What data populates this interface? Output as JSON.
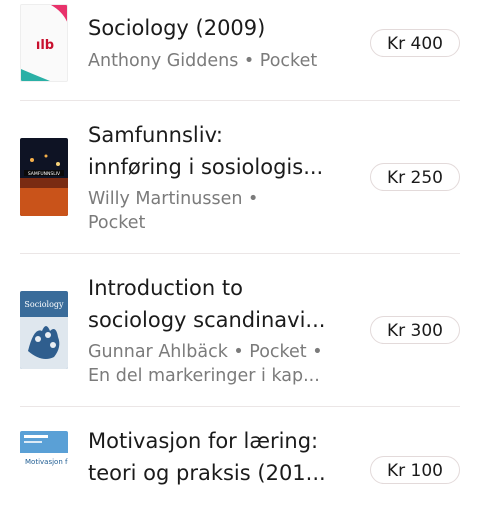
{
  "items": [
    {
      "title_lines": [
        "Sociology (2009)"
      ],
      "subtitle_lines": [
        "Anthony Giddens • Pocket"
      ],
      "price": "Kr 400",
      "cover": {
        "kind": "placeholder",
        "text": "ılb",
        "accent_colors": [
          "#e8326b",
          "#2ab0a6"
        ]
      }
    },
    {
      "title_lines": [
        "Samfunnsliv:",
        "innføring i sosiologis..."
      ],
      "subtitle_lines": [
        "Willy Martinussen •",
        "Pocket"
      ],
      "price": "Kr 250",
      "cover": {
        "kind": "photo",
        "text": "SAMFUNNSLIV",
        "colors": [
          "#0e1324",
          "#c9531a"
        ]
      }
    },
    {
      "title_lines": [
        "Introduction to",
        "sociology scandinavi..."
      ],
      "subtitle_lines": [
        "Gunnar Ahlbäck • Pocket •",
        "En del markeringer i kap..."
      ],
      "price": "Kr 300",
      "cover": {
        "kind": "photo",
        "text": "Sociology",
        "colors": [
          "#3a6c9a",
          "#e9eef3"
        ]
      }
    },
    {
      "title_lines": [
        "Motivasjon for læring:",
        "teori og praksis (201..."
      ],
      "subtitle_lines": [],
      "price": "Kr 100",
      "cover": {
        "kind": "photo",
        "text": "Motivasjon for læring",
        "colors": [
          "#5aa0d6",
          "#ffffff"
        ]
      }
    }
  ]
}
